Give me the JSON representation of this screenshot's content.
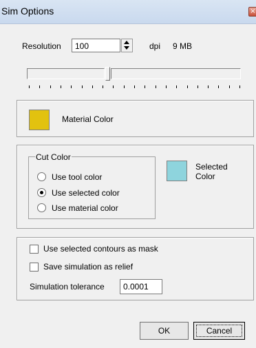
{
  "window": {
    "title": "Sim Options",
    "close_glyph": "×"
  },
  "resolution": {
    "label": "Resolution",
    "value": "100",
    "unit": "dpi",
    "size_text": "9 MB",
    "slider_fraction": 0.4
  },
  "material": {
    "label": "Material Color",
    "color": "#e2c20f"
  },
  "cut_color": {
    "group_label": "Cut Color",
    "options": [
      {
        "label": "Use tool color",
        "checked": false
      },
      {
        "label": "Use selected color",
        "checked": true
      },
      {
        "label": "Use material color",
        "checked": false
      }
    ],
    "selected_color_label": "Selected Color",
    "selected_color_line1": "Selected",
    "selected_color_line2": "Color",
    "selected_color": "#8ed4dd"
  },
  "options": {
    "mask_label": "Use selected contours as mask",
    "mask_checked": false,
    "relief_label": "Save simulation as relief",
    "relief_checked": false,
    "tolerance_label": "Simulation tolerance",
    "tolerance_value": "0.0001"
  },
  "buttons": {
    "ok": "OK",
    "cancel": "Cancel"
  }
}
